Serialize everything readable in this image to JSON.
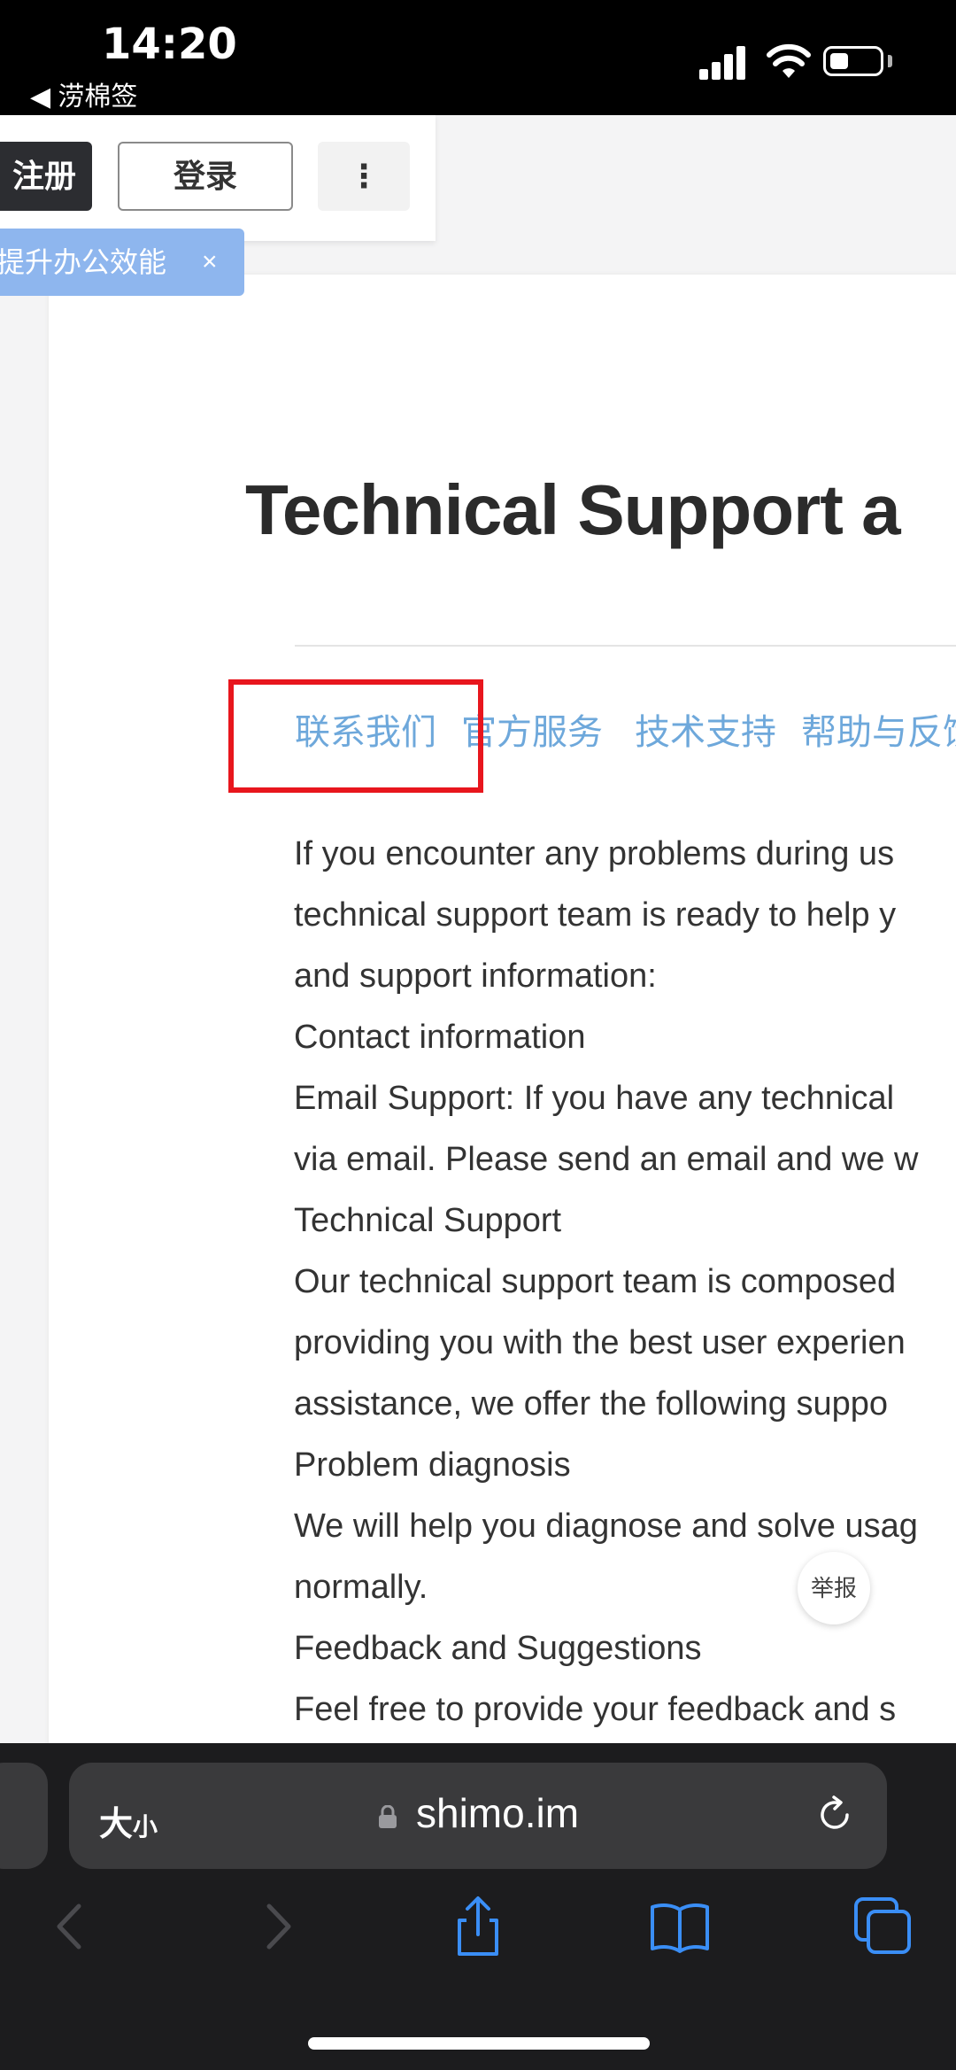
{
  "status_bar": {
    "time": "14:20",
    "back_app": "◀ 涝棉签"
  },
  "toolbar": {
    "register_label": "注册",
    "login_label": "登录",
    "more_label": "⋮"
  },
  "promo": {
    "text": "提升办公效能",
    "close": "×"
  },
  "document": {
    "title": "Technical Support a",
    "links": [
      "联系我们",
      "官方服务",
      "技术支持",
      "帮助与反馈"
    ],
    "lines": [
      "If you encounter any problems during us",
      "technical support team is ready to help y",
      "and support information:",
      "Contact information",
      "Email Support: If you have any technical",
      "via email. Please send an email and we w",
      "Technical Support",
      "Our technical support team is composed",
      "providing you with the best user experien",
      "assistance, we offer the following suppo",
      "Problem diagnosis",
      "We will help you diagnose and solve usag",
      "normally.",
      "Feedback and Suggestions",
      "Feel free to provide your feedback and s"
    ],
    "report_label": "举报"
  },
  "safari": {
    "text_size_big": "大",
    "text_size_small": "小",
    "url": "shimo.im"
  },
  "colors": {
    "link": "#6ea8db",
    "highlight": "#e8161d",
    "promo": "#8eb6ee",
    "safari_accent": "#3a8ef6"
  }
}
